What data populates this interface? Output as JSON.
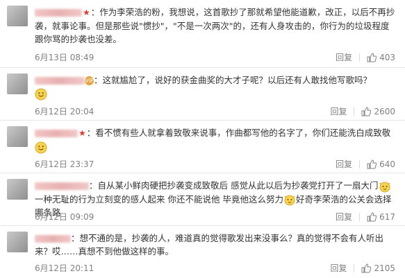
{
  "comments": [
    {
      "text": "作为李荣浩的粉，我想说，这首歌抄了那就希望他能道歉，改正，以后不再抄袭，就事论事。但是那些说\"惯抄\"，\"不是一次两次\"的，还有人身攻击的，你行为的垃圾程度跟你骂的抄袭也没差。",
      "time": "6月13日 08:49",
      "reply": "回复",
      "likes": "403",
      "badge": "star"
    },
    {
      "text": "这就尴尬了，说好的获金曲奖的大才子呢？以后还有人敢找他写歌吗？",
      "time": "6月12日 20:04",
      "reply": "回复",
      "likes": "2600",
      "badge": "circle",
      "badge_text": "VIP",
      "emoji": "smile"
    },
    {
      "text": "看不惯有些人就拿着致敬来说事，作曲都写他的名字了，你们还能洗白成致敬",
      "time": "6月12日 23:37",
      "reply": "回复",
      "likes": "640",
      "badge": "star",
      "emoji": "smile"
    },
    {
      "text_a": "自从某小鲜肉硬把抄袭变成致敬后 感觉从此以后为抄袭党打开了一扇大门",
      "text_b": "一种无耻的行为立刻变的感人起来 你还不能说他 毕竟他这么努力",
      "text_c": "好奇李荣浩的公关会选择哪条路",
      "time": "6月12日 09:09",
      "reply": "回复",
      "likes": "617"
    },
    {
      "text": "想不通的是，抄袭的人，难道真的觉得歌发出来没事么？真的觉得不会有人听出来？哎……真想不到他做这样的事。",
      "time": "6月12日 20:11",
      "reply": "回复",
      "likes": "2105"
    }
  ]
}
